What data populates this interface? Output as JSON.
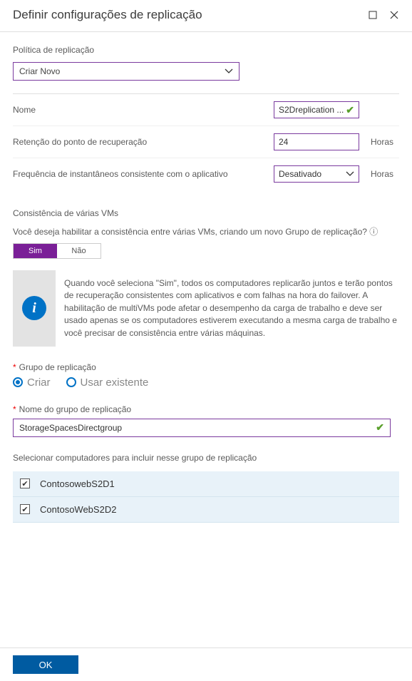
{
  "header": {
    "title": "Definir configurações de replicação"
  },
  "policy": {
    "label": "Política de replicação",
    "selected": "Criar Novo"
  },
  "form": {
    "name_label": "Nome",
    "name_value": "S2Dreplication ...",
    "retention_label": "Retenção do ponto de recuperação",
    "retention_value": "24",
    "retention_unit": "Horas",
    "snapshot_label": "Frequência de instantâneos consistente com o aplicativo",
    "snapshot_value": "Desativado",
    "snapshot_unit": "Horas"
  },
  "multivm": {
    "heading": "Consistência de várias VMs",
    "question": "Você deseja habilitar a consistência entre várias VMs, criando um novo Grupo de replicação? ⓘ",
    "yes": "Sim",
    "no": "Não",
    "info": "Quando você seleciona \"Sim\", todos os computadores replicarão juntos e terão pontos de recuperação consistentes com aplicativos e com falhas na hora do failover. A habilitação de multiVMs pode afetar o desempenho da carga de trabalho e deve ser usado apenas se os computadores estiverem executando a mesma carga de trabalho e você precisar de consistência entre várias máquinas."
  },
  "repgroup": {
    "label": "Grupo de replicação",
    "opt_create": "Criar",
    "opt_existing": "Usar existente",
    "name_label": "Nome do grupo de replicação",
    "name_value": "StorageSpacesDirectgroup"
  },
  "computers": {
    "label": "Selecionar computadores para incluir nesse grupo de replicação",
    "items": [
      {
        "name": "ContosowebS2D1",
        "checked": true
      },
      {
        "name": "ContosoWebS2D2",
        "checked": true
      }
    ]
  },
  "footer": {
    "ok": "OK"
  }
}
